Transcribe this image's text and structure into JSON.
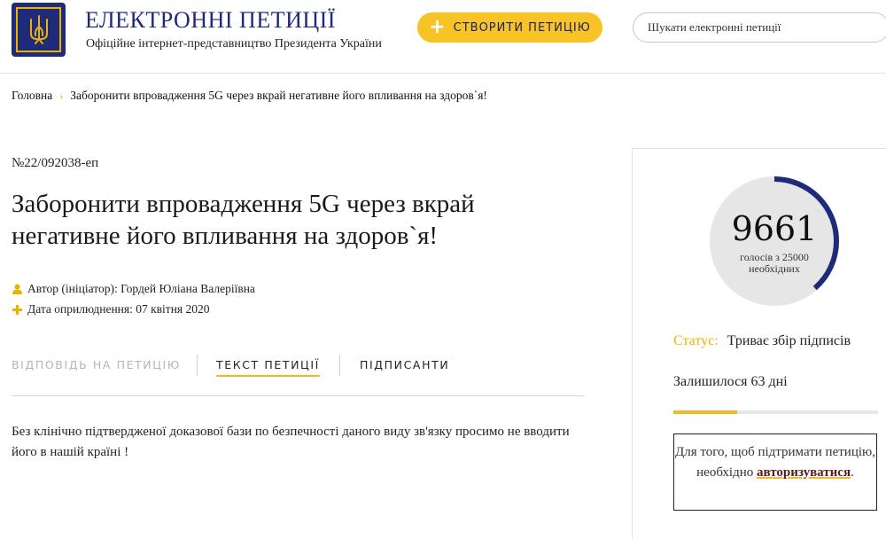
{
  "header": {
    "site_title": "ЕЛЕКТРОННІ ПЕТИЦІЇ",
    "site_subtitle": "Офіційне інтернет-представництво Президента України",
    "create_button": "СТВОРИТИ ПЕТИЦІЮ",
    "search_placeholder": "Шукати електронні петиції",
    "colors": {
      "brand": "#1f2a78",
      "accent": "#f7c325"
    }
  },
  "breadcrumb": {
    "home": "Головна",
    "current": "Заборонити впровадження 5G через вкрай негативне його впливання на здоров`я!"
  },
  "petition": {
    "number": "№22/092038-еп",
    "title": "Заборонити впровадження 5G через вкрай негативне його впливання на здоров`я!",
    "author_label": "Автор (ініціатор): Гордей Юліана Валеріївна",
    "date_label": "Дата оприлюднення: 07 квітня 2020",
    "body": "Без клінічно підтвердженої доказової бази по безпечності даного виду зв'язку просимо не вводити його в нашій країні !"
  },
  "tabs": [
    {
      "label": "ВІДПОВІДЬ НА ПЕТИЦІЮ",
      "active": false
    },
    {
      "label": "ТЕКСТ ПЕТИЦІЇ",
      "active": true
    },
    {
      "label": "ПІДПИСАНТИ",
      "active": false
    }
  ],
  "sidebar": {
    "votes": "9661",
    "votes_sub_line1": "голосів з 25000",
    "votes_sub_line2": "необхідних",
    "votes_value": 9661,
    "votes_needed": 25000,
    "status_label": "Статус:",
    "status_value": "Триває збір підписів",
    "remaining": "Залишилося 63 дні",
    "time_progress": 0.31,
    "auth_text_1": "Для того, щоб підтримати петицію, необхідно",
    "auth_link": "авторизуватися",
    "auth_text_2": "."
  }
}
